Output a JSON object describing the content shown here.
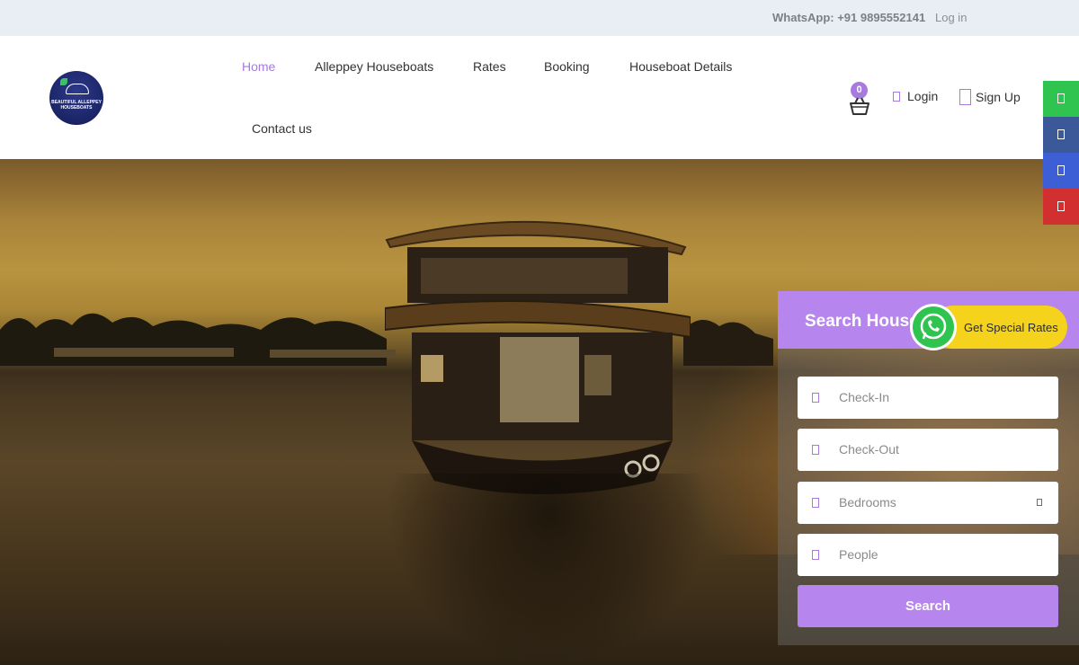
{
  "topbar": {
    "whatsapp_text": "WhatsApp: +91 9895552141",
    "login_link": "Log in"
  },
  "logo": {
    "line1": "BEAUTIFUL ALLEPPEY",
    "line2": "HOUSEBOATS"
  },
  "nav": {
    "items": [
      {
        "label": "Home",
        "active": true
      },
      {
        "label": "Alleppey Houseboats"
      },
      {
        "label": "Rates"
      },
      {
        "label": "Booking"
      },
      {
        "label": "Houseboat Details"
      },
      {
        "label": "Contact us"
      }
    ]
  },
  "header": {
    "cart_count": "0",
    "login_label": "Login",
    "signup_label": "Sign Up"
  },
  "social": [
    {
      "icon": "whatsapp-icon",
      "color": "#2ec44f"
    },
    {
      "icon": "facebook-icon",
      "color": "#3b5998"
    },
    {
      "icon": "linkedin-icon",
      "color": "#3c5fd6"
    },
    {
      "icon": "youtube-icon",
      "color": "#d23030"
    }
  ],
  "search_panel": {
    "title": "Search House",
    "fields": [
      {
        "placeholder": "Check-In",
        "icon": "calendar-icon"
      },
      {
        "placeholder": "Check-Out",
        "icon": "calendar-icon"
      },
      {
        "placeholder": "Bedrooms",
        "icon": "bed-icon",
        "dropdown": true
      },
      {
        "placeholder": "People",
        "icon": "user-icon"
      }
    ],
    "button_label": "Search"
  },
  "special_rates": {
    "label": "Get Special Rates"
  },
  "colors": {
    "accent": "#a77bde",
    "panel_header": "#b685ee",
    "whatsapp_green": "#2ec44f",
    "special_yellow": "#f5d21c"
  }
}
